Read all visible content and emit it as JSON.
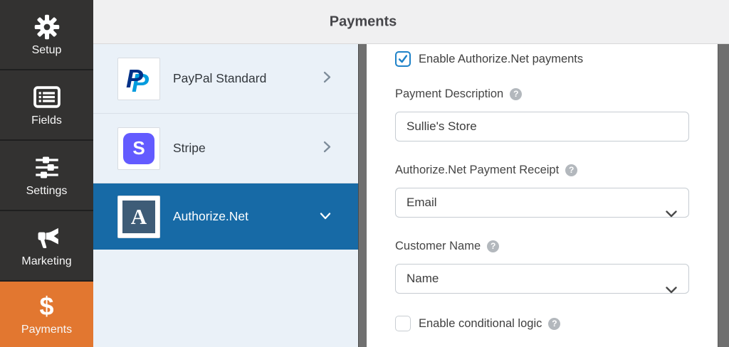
{
  "header": {
    "title": "Payments"
  },
  "sidebar": {
    "items": [
      {
        "label": "Setup",
        "icon": "gear-icon",
        "active": false
      },
      {
        "label": "Fields",
        "icon": "fields-icon",
        "active": false
      },
      {
        "label": "Settings",
        "icon": "sliders-icon",
        "active": false
      },
      {
        "label": "Marketing",
        "icon": "megaphone-icon",
        "active": false
      },
      {
        "label": "Payments",
        "icon": "dollar-icon",
        "active": true
      }
    ]
  },
  "providers": {
    "items": [
      {
        "label": "PayPal Standard",
        "expanded": false,
        "selected": false
      },
      {
        "label": "Stripe",
        "expanded": false,
        "selected": false
      },
      {
        "label": "Authorize.Net",
        "expanded": true,
        "selected": true
      }
    ]
  },
  "panel": {
    "enable": {
      "label": "Enable Authorize.Net payments",
      "checked": true
    },
    "description": {
      "label": "Payment Description",
      "value": "Sullie's Store"
    },
    "receipt": {
      "label": "Authorize.Net Payment Receipt",
      "value": "Email"
    },
    "customer": {
      "label": "Customer Name",
      "value": "Name"
    },
    "conditional": {
      "label": "Enable conditional logic",
      "checked": false
    },
    "help_glyph": "?"
  },
  "colors": {
    "accent_orange": "#e27730",
    "selected_blue": "#176aa6",
    "checkbox_blue": "#1e82c8",
    "stripe_purple": "#635bff",
    "paypal_dark": "#003087",
    "paypal_light": "#009cde",
    "authorize_navy": "#3e5c77"
  }
}
